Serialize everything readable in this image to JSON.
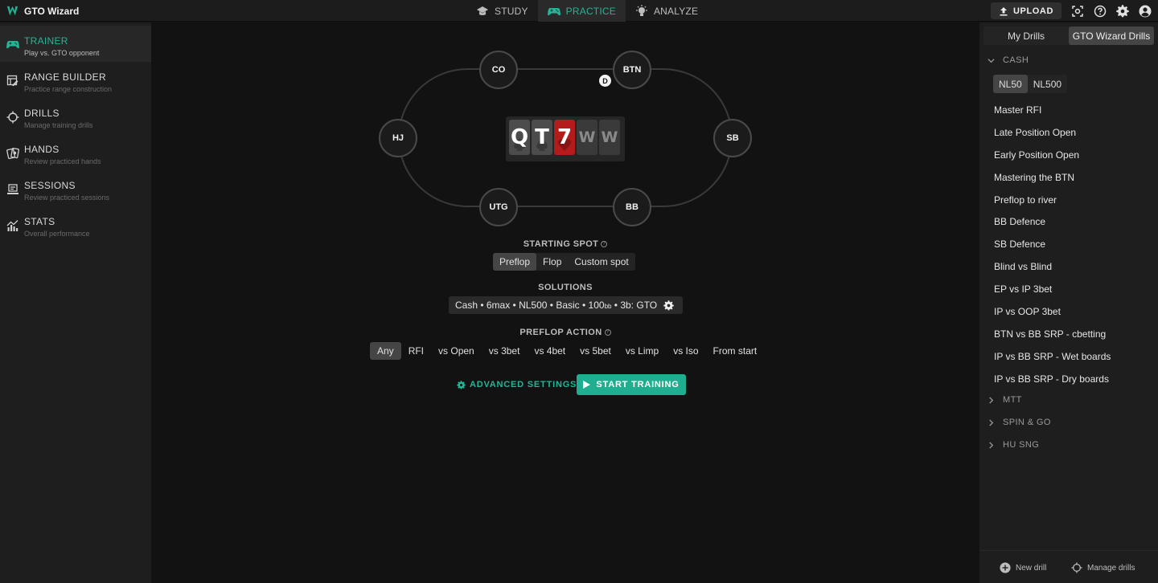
{
  "app": {
    "name": "GTO Wizard"
  },
  "topnav": {
    "tabs": [
      {
        "label": "STUDY",
        "icon": "study-cap-icon"
      },
      {
        "label": "PRACTICE",
        "icon": "gamepad-icon",
        "active": true
      },
      {
        "label": "ANALYZE",
        "icon": "lightbulb-icon"
      }
    ],
    "upload_label": "UPLOAD"
  },
  "sidebar": {
    "items": [
      {
        "title": "TRAINER",
        "subtitle": "Play vs. GTO opponent",
        "icon": "gamepad-icon",
        "active": true
      },
      {
        "title": "RANGE BUILDER",
        "subtitle": "Practice range construction",
        "icon": "range-edit-icon"
      },
      {
        "title": "DRILLS",
        "subtitle": "Manage training drills",
        "icon": "crosshair-icon"
      },
      {
        "title": "HANDS",
        "subtitle": "Review practiced hands",
        "icon": "cards-icon"
      },
      {
        "title": "SESSIONS",
        "subtitle": "Review practiced sessions",
        "icon": "laptop-icon"
      },
      {
        "title": "STATS",
        "subtitle": "Overall performance",
        "icon": "stats-icon"
      }
    ]
  },
  "table": {
    "seats": {
      "co": "CO",
      "btn": "BTN",
      "hj": "HJ",
      "sb": "SB",
      "utg": "UTG",
      "bb": "BB"
    },
    "dealer_label": "D",
    "board": [
      {
        "rank": "Q",
        "suit": "spade"
      },
      {
        "rank": "T",
        "suit": "spade"
      },
      {
        "rank": "7",
        "suit": "heart"
      },
      {
        "rank": "W",
        "suit": "empty"
      },
      {
        "rank": "W",
        "suit": "empty"
      }
    ]
  },
  "settings": {
    "starting_spot": {
      "title": "STARTING SPOT",
      "options": [
        "Preflop",
        "Flop",
        "Custom spot"
      ],
      "selected": "Preflop"
    },
    "solutions": {
      "title": "SOLUTIONS",
      "value": "Cash • 6max • NL500 • Basic • 100",
      "value_unit": "bb",
      "value_suffix": " • 3b: GTO"
    },
    "preflop_action": {
      "title": "PREFLOP ACTION",
      "options": [
        "Any",
        "RFI",
        "vs Open",
        "vs 3bet",
        "vs 4bet",
        "vs 5bet",
        "vs Limp",
        "vs Iso",
        "From start"
      ],
      "selected": "Any"
    },
    "advanced_label": "ADVANCED SETTINGS",
    "start_label": "START TRAINING"
  },
  "drills_panel": {
    "tabs": [
      "My Drills",
      "GTO Wizard Drills"
    ],
    "active_tab": "GTO Wizard Drills",
    "groups": {
      "cash": {
        "label": "CASH",
        "stakes": [
          "NL50",
          "NL500"
        ],
        "active_stake": "NL50",
        "items": [
          "Master RFI",
          "Late Position Open",
          "Early Position Open",
          "Mastering the BTN",
          "Preflop to river",
          "BB Defence",
          "SB Defence",
          "Blind vs Blind",
          "EP vs IP 3bet",
          "IP vs OOP 3bet",
          "BTN vs BB SRP - cbetting",
          "IP vs BB SRP - Wet boards",
          "IP vs BB SRP - Dry boards"
        ]
      },
      "mtt": {
        "label": "MTT"
      },
      "spin": {
        "label": "SPIN & GO"
      },
      "husng": {
        "label": "HU SNG"
      }
    },
    "footer": {
      "new_drill": "New drill",
      "manage_drills": "Manage drills"
    }
  },
  "colors": {
    "accent": "#21b796",
    "heart": "#b41c1c",
    "spade": "#4c4c4c"
  }
}
